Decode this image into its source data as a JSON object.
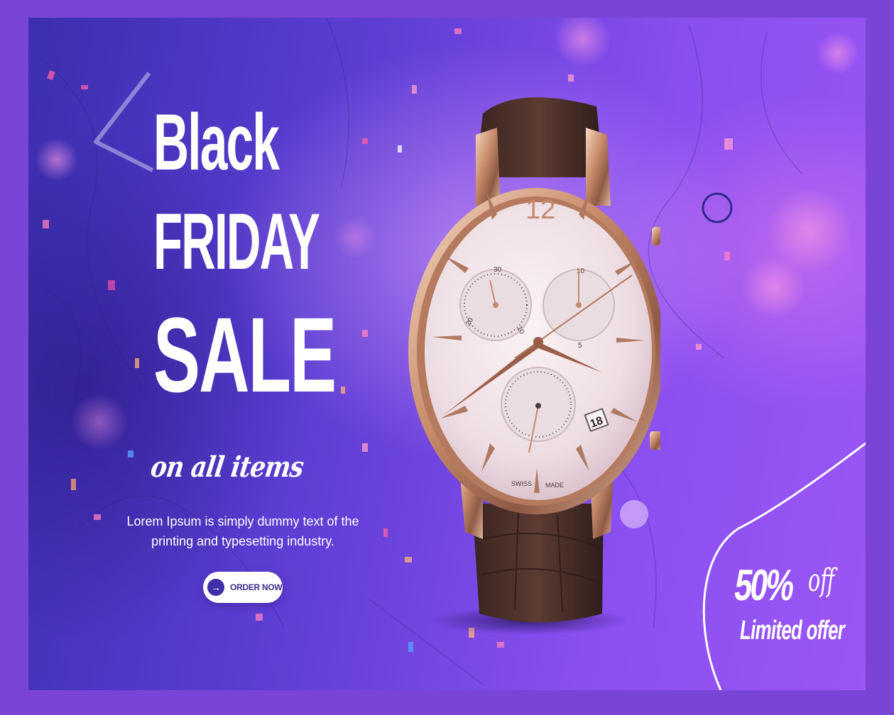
{
  "headline": {
    "line1": "Black",
    "line2": "FRIDAY",
    "line3": "SALE",
    "subline": "on all items"
  },
  "description": {
    "line1": "Lorem Ipsum is simply dummy text of the",
    "line2": "printing and typesetting industry."
  },
  "cta": {
    "label": "ORDER NOW",
    "icon": "arrow-right-icon"
  },
  "watch": {
    "dial_12": "12",
    "subdial_left_30": "30",
    "subdial_left_20": "20",
    "subdial_left_10": "10",
    "subdial_right_10": "10",
    "subdial_right_5": "5",
    "date": "18",
    "swiss": "SWISS",
    "made": "MADE"
  },
  "offer": {
    "percent": "50%",
    "off": "off",
    "limited": "Limited offer"
  },
  "colors": {
    "frame": "#7a45d6",
    "banner_left": "#3b2fae",
    "banner_right": "#9b56f5",
    "text": "#ffffff",
    "button_text": "#3a2d8f"
  }
}
